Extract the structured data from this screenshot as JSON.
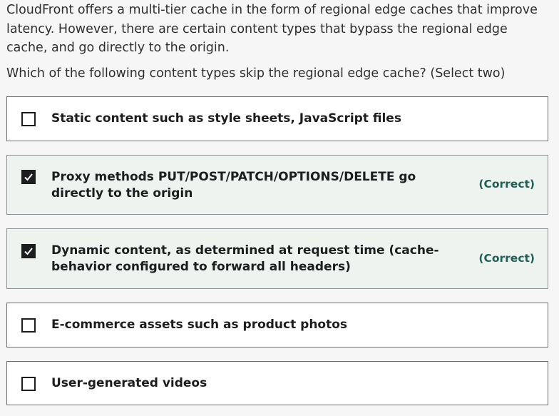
{
  "question": {
    "text": "CloudFront offers a multi-tier cache in the form of regional edge caches that improve latency. However, there are certain content types that bypass the regional edge cache, and go directly to the origin.",
    "prompt": "Which of the following content types skip the regional edge cache? (Select two)"
  },
  "options": [
    {
      "label": "Static content such as style sheets, JavaScript files",
      "checked": false,
      "badge": ""
    },
    {
      "label": "Proxy methods PUT/POST/PATCH/OPTIONS/DELETE go directly to the origin",
      "checked": true,
      "badge": "(Correct)"
    },
    {
      "label": "Dynamic content, as determined at request time (cache-behavior configured to forward all headers)",
      "checked": true,
      "badge": "(Correct)"
    },
    {
      "label": "E-commerce assets such as product photos",
      "checked": false,
      "badge": ""
    },
    {
      "label": "User-generated videos",
      "checked": false,
      "badge": ""
    }
  ],
  "colors": {
    "correct_text": "#1e6055",
    "correct_background": "#eef3f0"
  },
  "icons": {
    "checked": "checkmark-icon"
  }
}
